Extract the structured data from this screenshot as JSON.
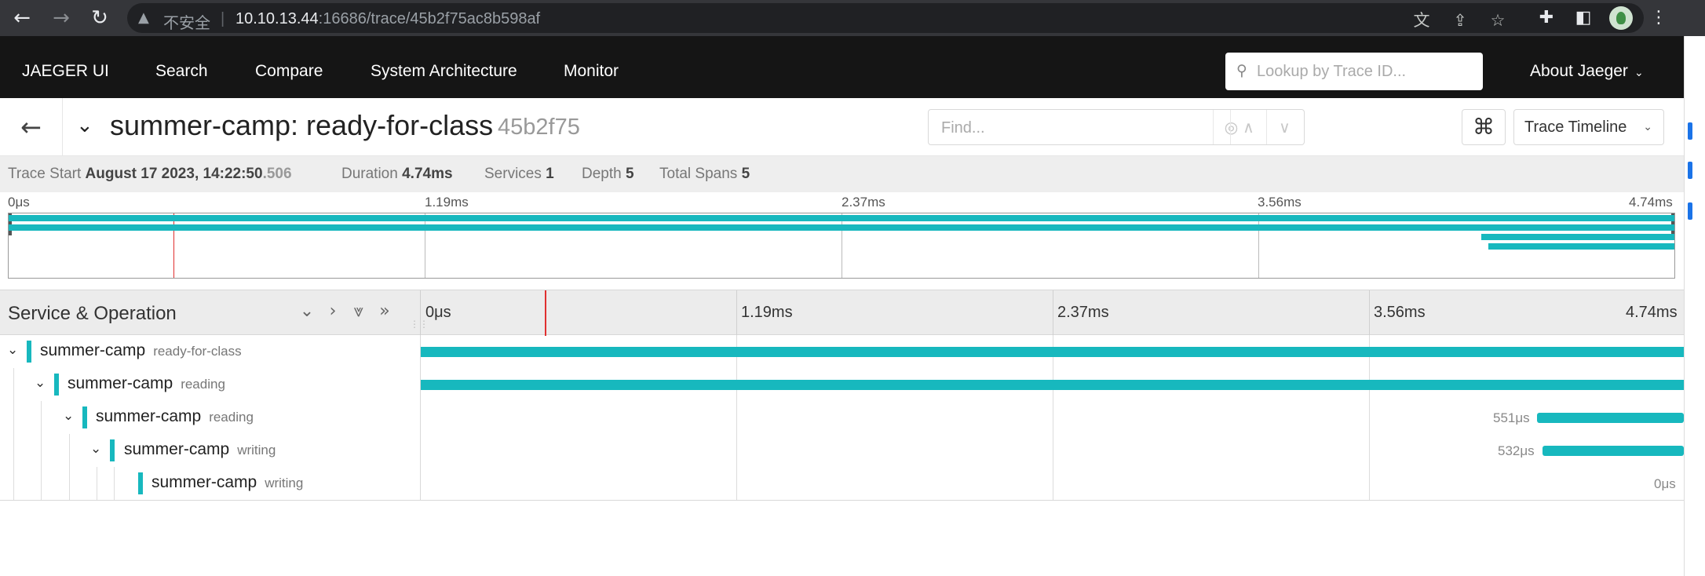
{
  "browser": {
    "insecure_label": "不安全",
    "url_host": "10.10.13.44",
    "url_rest": ":16686/trace/45b2f75ac8b598af"
  },
  "nav": {
    "brand": "JAEGER UI",
    "search": "Search",
    "compare": "Compare",
    "system_architecture": "System Architecture",
    "monitor": "Monitor",
    "lookup_placeholder": "Lookup by Trace ID...",
    "about": "About Jaeger"
  },
  "trace": {
    "title": "summer-camp: ready-for-class",
    "trace_id_short": "45b2f75",
    "find_placeholder": "Find...",
    "view_mode": "Trace Timeline"
  },
  "overview": {
    "start_label": "Trace Start",
    "start_value": "August 17 2023, 14:22:50",
    "start_ms": ".506",
    "duration_label": "Duration",
    "duration_value": "4.74ms",
    "services_label": "Services",
    "services_value": "1",
    "depth_label": "Depth",
    "depth_value": "5",
    "total_spans_label": "Total Spans",
    "total_spans_value": "5"
  },
  "ticks": [
    "0μs",
    "1.19ms",
    "2.37ms",
    "3.56ms",
    "4.74ms"
  ],
  "timeline": {
    "header_title": "Service & Operation"
  },
  "spans": [
    {
      "service": "summer-camp",
      "operation": "ready-for-class",
      "depth": 0,
      "start_ms": 0,
      "duration_ms": 4.74,
      "duration_label": ""
    },
    {
      "service": "summer-camp",
      "operation": "reading",
      "depth": 1,
      "start_ms": 0,
      "duration_ms": 4.74,
      "duration_label": ""
    },
    {
      "service": "summer-camp",
      "operation": "reading",
      "depth": 2,
      "start_ms": 4.19,
      "duration_ms": 0.551,
      "duration_label": "551μs"
    },
    {
      "service": "summer-camp",
      "operation": "writing",
      "depth": 3,
      "start_ms": 4.21,
      "duration_ms": 0.532,
      "duration_label": "532μs"
    },
    {
      "service": "summer-camp",
      "operation": "writing",
      "depth": 4,
      "start_ms": 4.74,
      "duration_ms": 0,
      "duration_label": "0μs"
    }
  ],
  "colors": {
    "span": "#17b8be",
    "cursor": "#e03030",
    "nav_bg": "#151515"
  }
}
